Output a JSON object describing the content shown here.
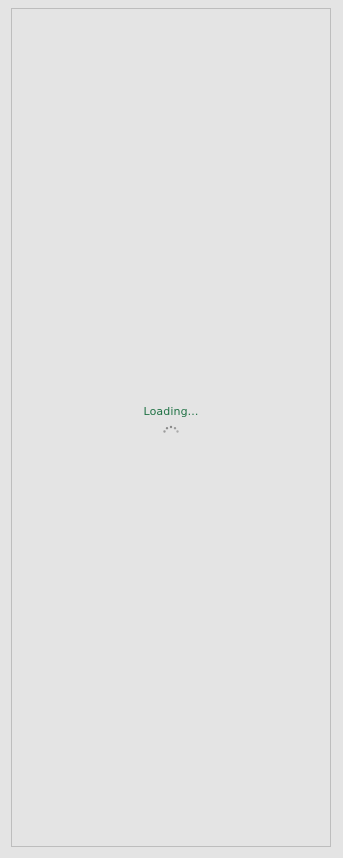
{
  "status": {
    "loading_text": "Loading..."
  },
  "icons": {
    "spinner": "loading-spinner-icon"
  },
  "colors": {
    "background": "#e4e4e4",
    "border": "#bdbdbd",
    "loading_text": "#217346",
    "spinner_dots": "#8a8a8a"
  }
}
